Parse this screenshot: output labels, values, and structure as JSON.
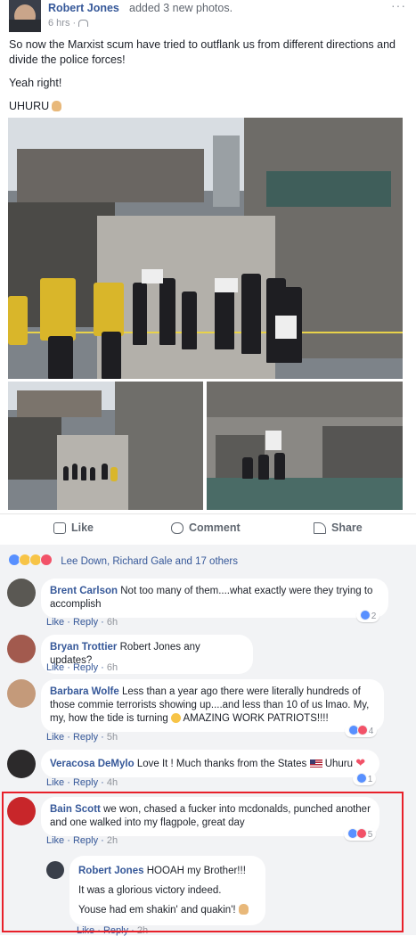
{
  "post": {
    "author": "Robert Jones",
    "action": "added 3 new photos.",
    "time": "6 hrs · ",
    "audience_icon": "friends-icon",
    "menu": "···",
    "paragraphs": [
      "So now the Marxist scum have tried to outflank us from different directions and divide the police forces!",
      "Yeah right!",
      "UHURU"
    ],
    "photos": [
      "police-and-protesters-photo",
      "courtyard-photo",
      "protester-sign-photo"
    ]
  },
  "actions": {
    "like": "Like",
    "comment": "Comment",
    "share": "Share"
  },
  "reactions": {
    "summary": "Lee Down, Richard Gale and 17 others"
  },
  "comments": [
    {
      "name": "Brent Carlson",
      "text": "Not too many of them....what exactly were they trying to accomplish",
      "like": "Like",
      "reply": "Reply",
      "time": "6h",
      "count": "2"
    },
    {
      "name": "Bryan Trottier",
      "text": "Robert Jones any updates?",
      "like": "Like",
      "reply": "Reply",
      "time": "6h",
      "count": ""
    },
    {
      "name": "Barbara Wolfe",
      "text": "Less than a year ago there were literally hundreds of those commie terrorists showing up....and less than 10 of us lmao. My, my, how the tide is turning",
      "text2": "AMAZING WORK PATRIOTS!!!!",
      "like": "Like",
      "reply": "Reply",
      "time": "5h",
      "count": "4"
    },
    {
      "name": "Veracosa DeMylo",
      "text": "Love It ! Much thanks from the States",
      "text2": "Uhuru",
      "like": "Like",
      "reply": "Reply",
      "time": "4h",
      "count": "1"
    },
    {
      "name": "Bain Scott",
      "text": "we won, chased a fucker into mcdonalds, punched another and one walked into my flagpole, great day",
      "like": "Like",
      "reply": "Reply",
      "time": "2h",
      "count": "5"
    }
  ],
  "reply": {
    "name": "Robert Jones",
    "line1": "HOOAH my Brother!!!",
    "line2": "It was a glorious victory indeed.",
    "line3": "Youse had em shakin' and quakin'!",
    "like": "Like",
    "reply": "Reply",
    "time": "2h"
  },
  "colors": {
    "link": "#365899",
    "highlight": "#e8202a",
    "comment_bg": "#f2f3f5"
  }
}
